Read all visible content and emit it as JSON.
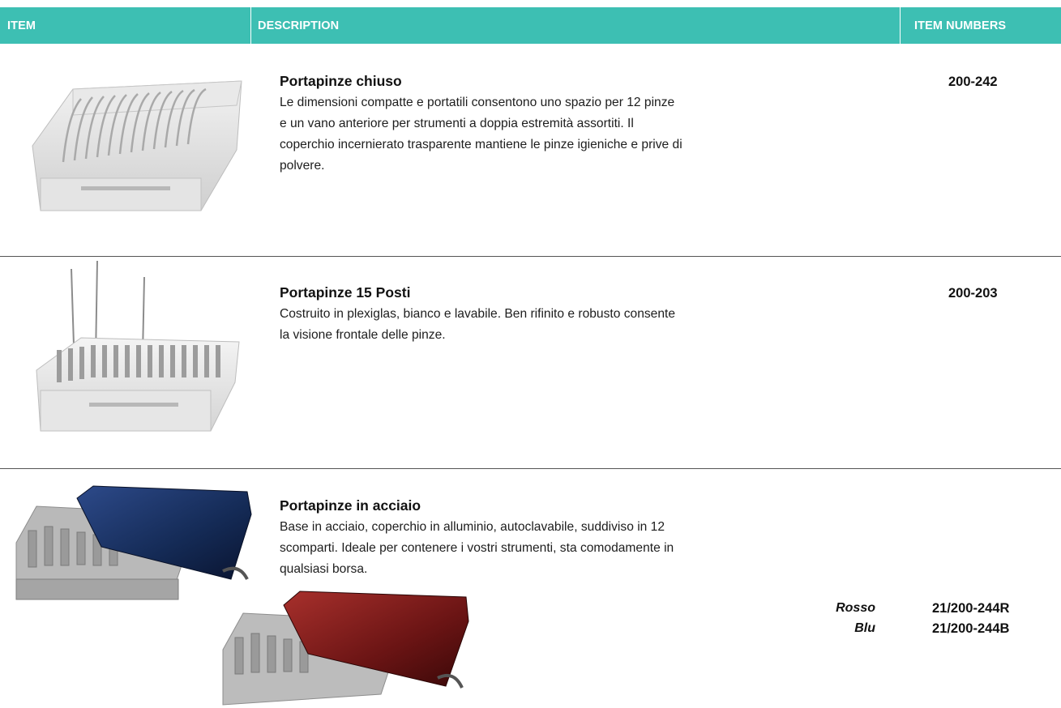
{
  "table": {
    "headers": {
      "item": "ITEM",
      "description": "DESCRIPTION",
      "item_numbers": "ITEM NUMBERS"
    },
    "accent_color": "#3dbfb3",
    "rows": [
      {
        "image": "closed-plier-holder-image",
        "title": "Portapinze chiuso",
        "description": "Le dimensioni compatte e portatili consentono uno spazio per 12 pinze e un vano anteriore per strumenti a doppia estremità assortiti. Il coperchio incernierato trasparente mantiene le pinze igieniche e prive di polvere.",
        "item_number": "200-242"
      },
      {
        "image": "15-slot-plier-holder-image",
        "title": "Portapinze 15 Posti",
        "description": "Costruito in plexiglas, bianco e lavabile. Ben rifinito e robusto consente la visione frontale delle pinze.",
        "item_number": "200-203"
      },
      {
        "image": "steel-plier-holder-image",
        "title": "Portapinze in acciaio",
        "description": "Base in acciaio, coperchio in alluminio, autoclavabile, suddiviso in 12 scomparti. Ideale per contenere i vostri strumenti, sta comodamente in qualsiasi borsa.",
        "variants": [
          {
            "label": "Rosso",
            "item_number": "21/200-244R"
          },
          {
            "label": "Blu",
            "item_number": "21/200-244B"
          }
        ]
      }
    ]
  }
}
